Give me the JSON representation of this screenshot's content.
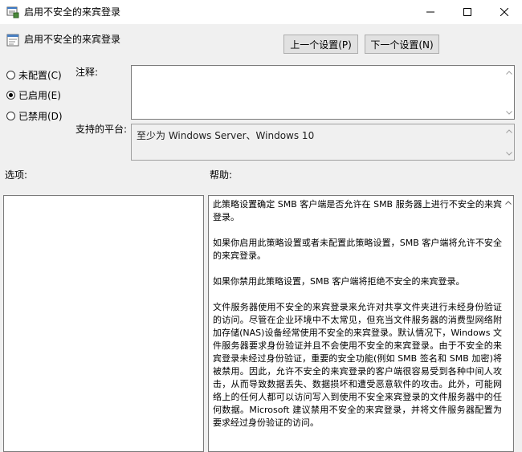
{
  "window": {
    "title": "启用不安全的来宾登录",
    "controls": [
      "minimize-icon",
      "maximize-icon",
      "close-icon"
    ]
  },
  "header": {
    "title": "启用不安全的来宾登录",
    "prev_label": "上一个设置(P)",
    "next_label": "下一个设置(N)"
  },
  "state": {
    "options": [
      {
        "label": "未配置(C)",
        "checked": false
      },
      {
        "label": "已启用(E)",
        "checked": true
      },
      {
        "label": "已禁用(D)",
        "checked": false
      }
    ]
  },
  "comment": {
    "label": "注释:",
    "value": ""
  },
  "platform": {
    "label": "支持的平台:",
    "value": "至少为 Windows Server、Windows 10"
  },
  "options_label": "选项:",
  "help": {
    "label": "帮助:",
    "paragraphs": [
      "此策略设置确定 SMB 客户端是否允许在 SMB 服务器上进行不安全的来宾登录。",
      "如果你启用此策略设置或者未配置此策略设置，SMB 客户端将允许不安全的来宾登录。",
      "如果你禁用此策略设置，SMB 客户端将拒绝不安全的来宾登录。",
      "文件服务器使用不安全的来宾登录来允许对共享文件夹进行未经身份验证的访问。尽管在企业环境中不太常见，但充当文件服务器的消费型网络附加存储(NAS)设备经常使用不安全的来宾登录。默认情况下，Windows 文件服务器要求身份验证并且不会使用不安全的来宾登录。由于不安全的来宾登录未经过身份验证，重要的安全功能(例如 SMB 签名和 SMB 加密)将被禁用。因此，允许不安全的来宾登录的客户端很容易受到各种中间人攻击，从而导致数据丢失、数据损坏和遭受恶意软件的攻击。此外，可能网络上的任何人都可以访问写入到使用不安全来宾登录的文件服务器中的任何数据。Microsoft 建议禁用不安全的来宾登录，并将文件服务器配置为要求经过身份验证的访问。"
    ]
  }
}
